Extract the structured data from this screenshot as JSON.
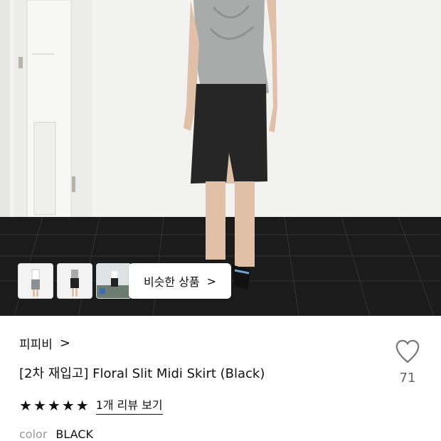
{
  "hero": {
    "similar_button_label": "비슷한 상품",
    "similar_button_icon": "chevron-right-icon",
    "thumbnails": [
      "thumbnail-1",
      "thumbnail-2",
      "thumbnail-3"
    ]
  },
  "product": {
    "brand": "피피비",
    "brand_icon": "chevron-right-icon",
    "title": "[2차 재입고] Floral Slit Midi Skirt (Black)",
    "like_count": "71",
    "like_icon": "heart-outline-icon",
    "rating_stars": 5,
    "star_glyph": "★",
    "review_link": "1개 리뷰 보기",
    "color_label": "color",
    "color_value": "BLACK"
  },
  "colors": {
    "text": "#111111",
    "muted": "#999999",
    "heart_stroke": "#777777"
  }
}
